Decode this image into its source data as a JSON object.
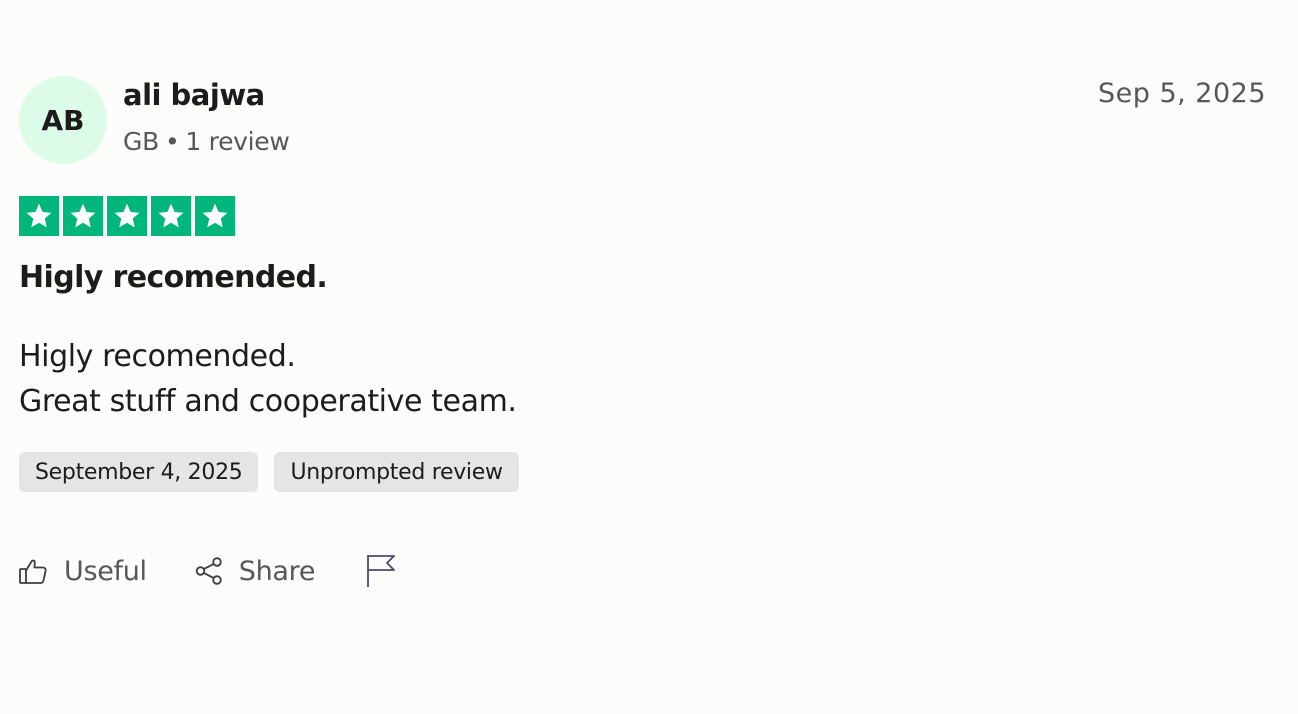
{
  "reviewer": {
    "initials": "AB",
    "name": "ali bajwa",
    "country": "GB",
    "separator": "•",
    "review_count": "1 review",
    "avatar_color": "#dcfce7"
  },
  "review": {
    "posted_date": "Sep 5, 2025",
    "rating": 5,
    "rating_max": 5,
    "star_color": "#00b67a",
    "title": "Higly recomended.",
    "body_lines": [
      "Higly recomended.",
      "Great stuff and cooperative team."
    ],
    "tags": [
      "September 4, 2025",
      "Unprompted review"
    ]
  },
  "actions": {
    "useful_label": "Useful",
    "useful_icon": "thumbs-up-icon",
    "share_label": "Share",
    "share_icon": "share-icon",
    "report_icon": "flag-icon"
  }
}
